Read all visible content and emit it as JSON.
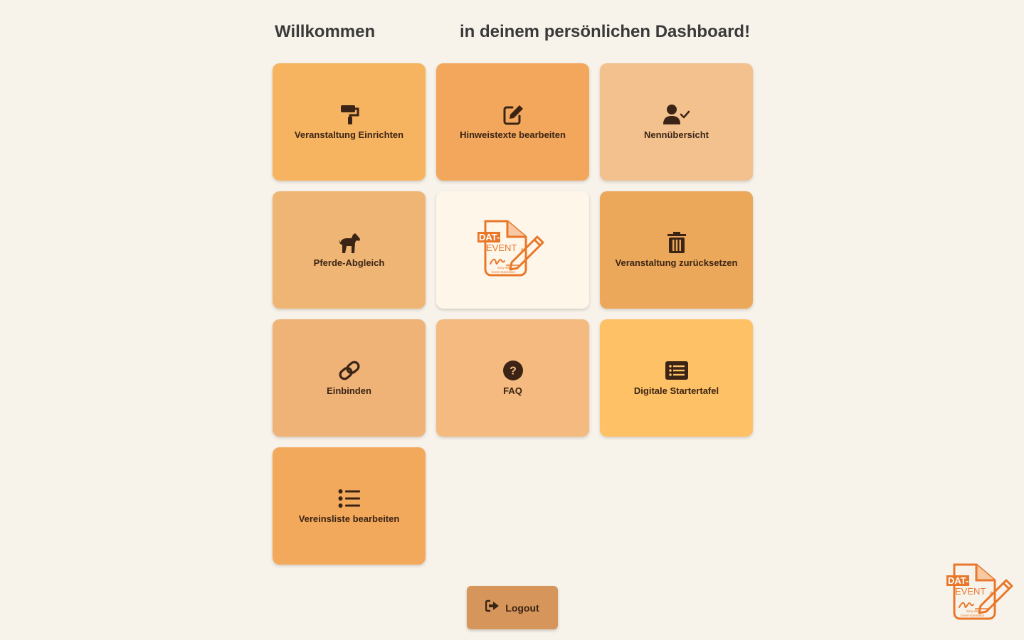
{
  "header": {
    "welcome_word": "Willkommen",
    "welcome_rest": "in deinem persönlichen Dashboard!"
  },
  "tiles": [
    {
      "label": "Veranstaltung Einrichten",
      "icon": "paint-roller-icon",
      "color": "#f6b460"
    },
    {
      "label": "Hinweistexte bearbeiten",
      "icon": "edit-icon",
      "color": "#f2a75c"
    },
    {
      "label": "Nennübersicht",
      "icon": "user-check-icon",
      "color": "#f2c18e"
    },
    {
      "label": "Pferde-Abgleich",
      "icon": "horse-icon",
      "color": "#efb574"
    },
    {
      "label": "DAT-EVENT.de logo",
      "icon": "dat-event-logo",
      "color": "#fef6e8"
    },
    {
      "label": "Veranstaltung zurücksetzen",
      "icon": "trash-icon",
      "color": "#eba85a"
    },
    {
      "label": "Einbinden",
      "icon": "link-icon",
      "color": "#efb277"
    },
    {
      "label": "FAQ",
      "icon": "question-circle-icon",
      "color": "#f4ba80"
    },
    {
      "label": "Digitale Startertafel",
      "icon": "list-alt-icon",
      "color": "#fec165"
    },
    {
      "label": "Vereinsliste bearbeiten",
      "icon": "list-icon",
      "color": "#f3a95b"
    }
  ],
  "logout": {
    "label": "Logout",
    "icon": "sign-out-icon",
    "color": "#d6955b"
  },
  "logo": {
    "line1": "DAT-",
    "line2": "EVENT",
    "suffix": ".de",
    "sub1": "Sicly-Wild",
    "sub2": "Event-Generator",
    "accent": "#e8772a"
  }
}
